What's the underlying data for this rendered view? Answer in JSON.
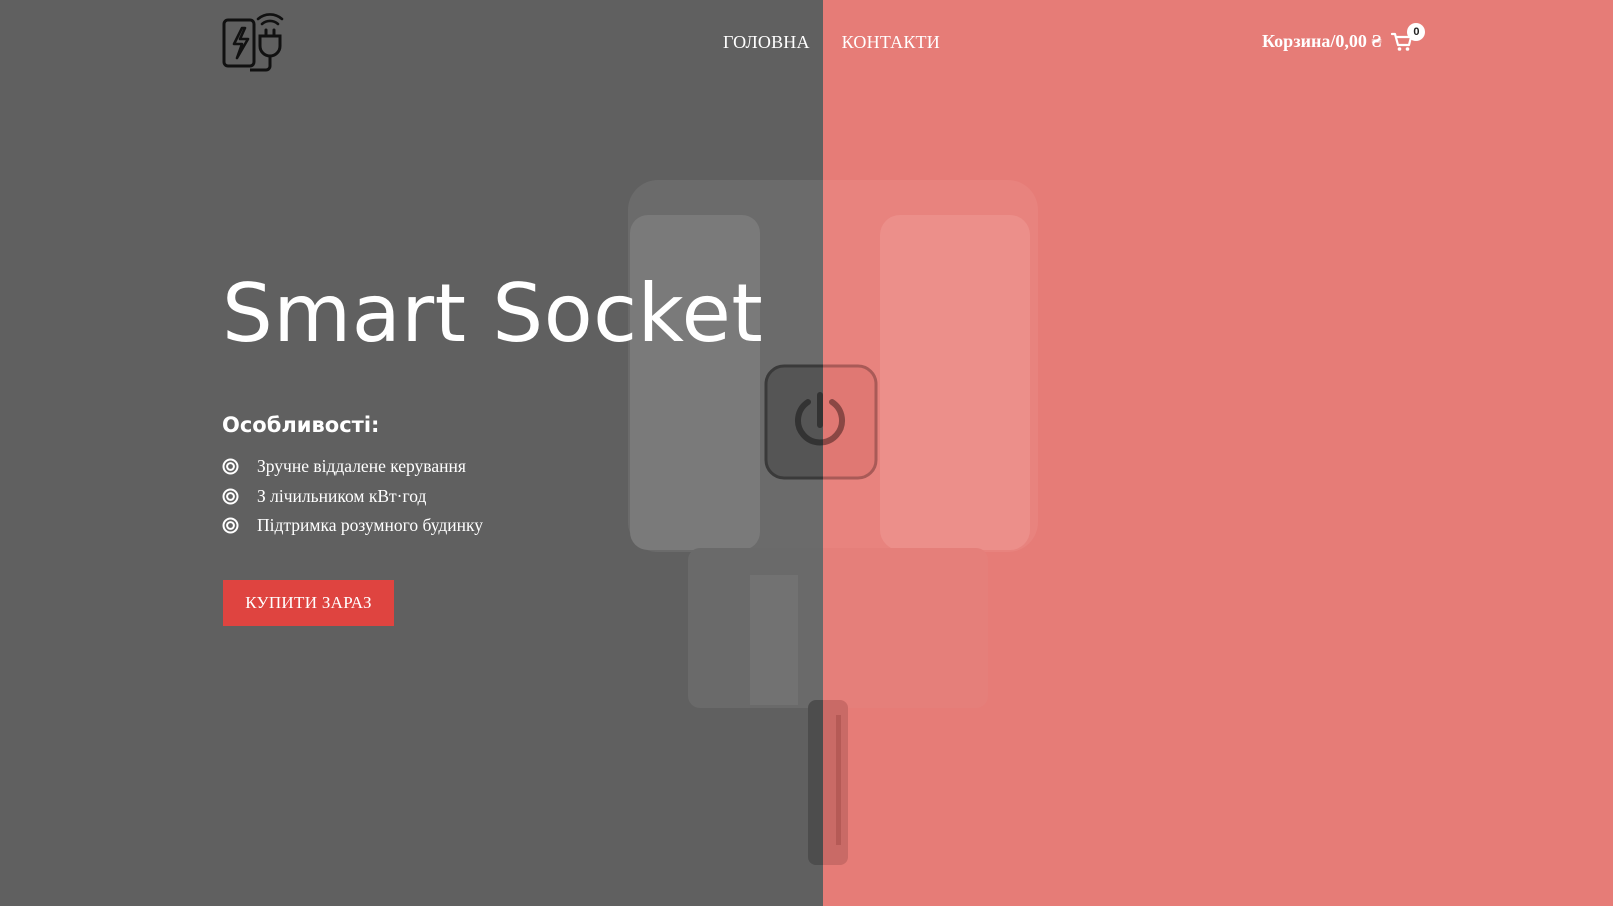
{
  "header": {
    "logo_icon": "smart-plug-icon",
    "nav": [
      {
        "label": "ГОЛОВНА"
      },
      {
        "label": "КОНТАКТИ"
      }
    ],
    "cart": {
      "label": "Корзина",
      "separator": "/",
      "total": "0,00 ₴",
      "count": "0",
      "icon": "cart-icon"
    }
  },
  "hero": {
    "title": "Smart Socket",
    "features_heading": "Особливості:",
    "features": [
      {
        "text": "Зручне віддалене керування",
        "icon": "target-bullet-icon"
      },
      {
        "text": "З лічильником кВт·год",
        "icon": "target-bullet-icon"
      },
      {
        "text": "Підтримка розумного будинку",
        "icon": "target-bullet-icon"
      }
    ],
    "cta_label": "КУПИТИ ЗАРАЗ"
  },
  "colors": {
    "left_panel": "#606060",
    "right_panel": "#e67c77",
    "cta": "#df4440",
    "text": "#ffffff"
  }
}
